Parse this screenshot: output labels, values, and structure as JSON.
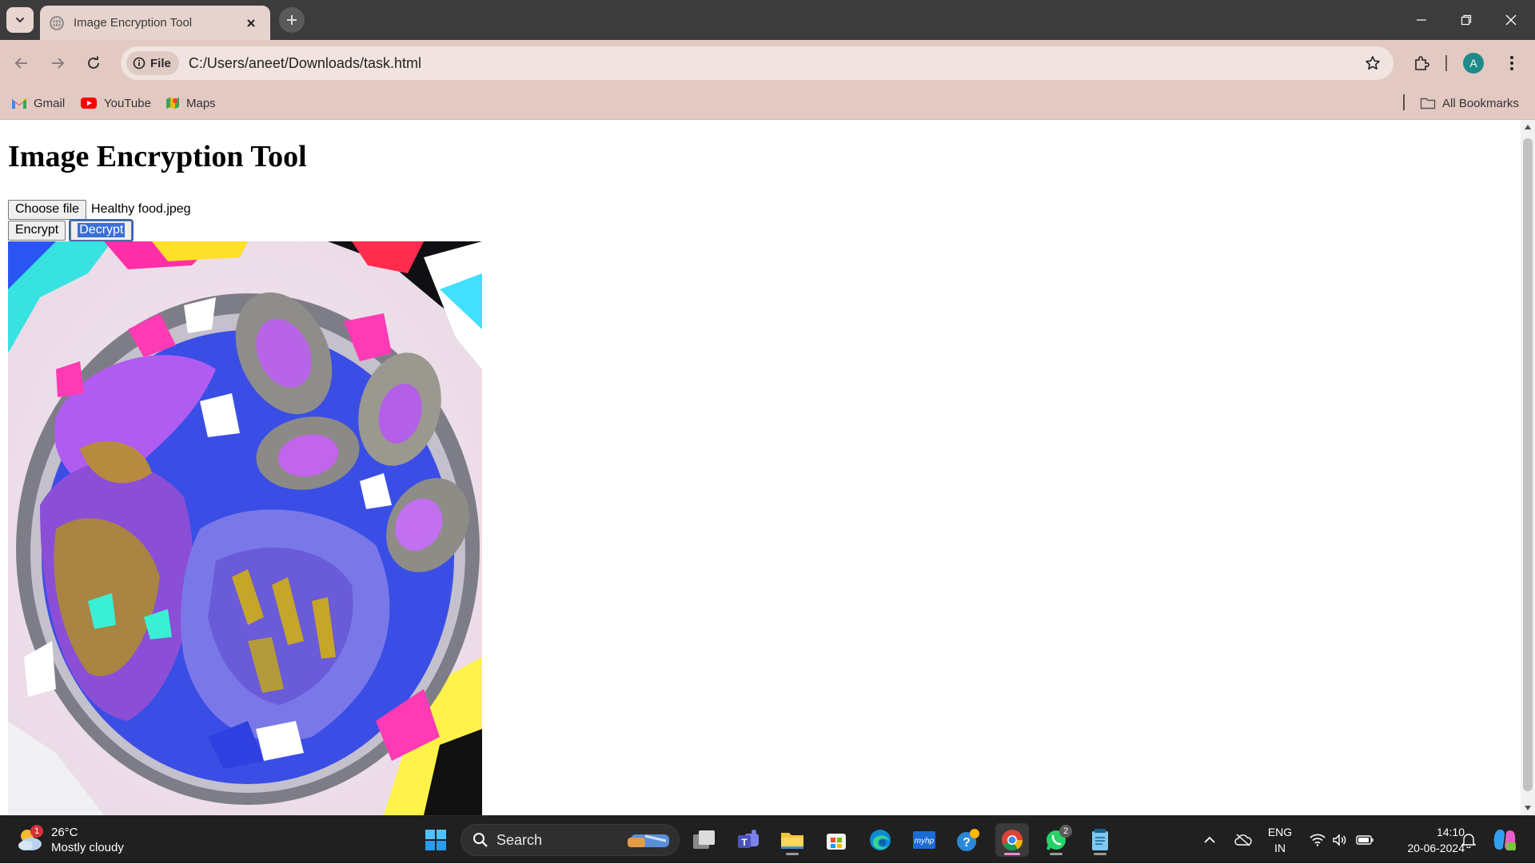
{
  "browser": {
    "tab_title": "Image Encryption Tool",
    "site_chip": "File",
    "url": "C:/Users/aneet/Downloads/task.html",
    "profile_initial": "A",
    "accent": "#e2c9c1"
  },
  "bookmarks": {
    "items": [
      {
        "label": "Gmail",
        "icon": "gmail-icon"
      },
      {
        "label": "YouTube",
        "icon": "youtube-icon"
      },
      {
        "label": "Maps",
        "icon": "maps-icon"
      }
    ],
    "all_bookmarks": "All Bookmarks"
  },
  "page": {
    "heading": "Image Encryption Tool",
    "choose_file_label": "Choose file",
    "file_name": "Healthy food.jpeg",
    "encrypt_label": "Encrypt",
    "decrypt_label": "Decrypt"
  },
  "taskbar": {
    "weather_temp": "26°C",
    "weather_desc": "Mostly cloudy",
    "weather_badge": "1",
    "search_label": "Search",
    "whatsapp_badge": "2",
    "lang_line1": "ENG",
    "lang_line2": "IN",
    "time": "14:10",
    "date": "20-06-2024"
  }
}
